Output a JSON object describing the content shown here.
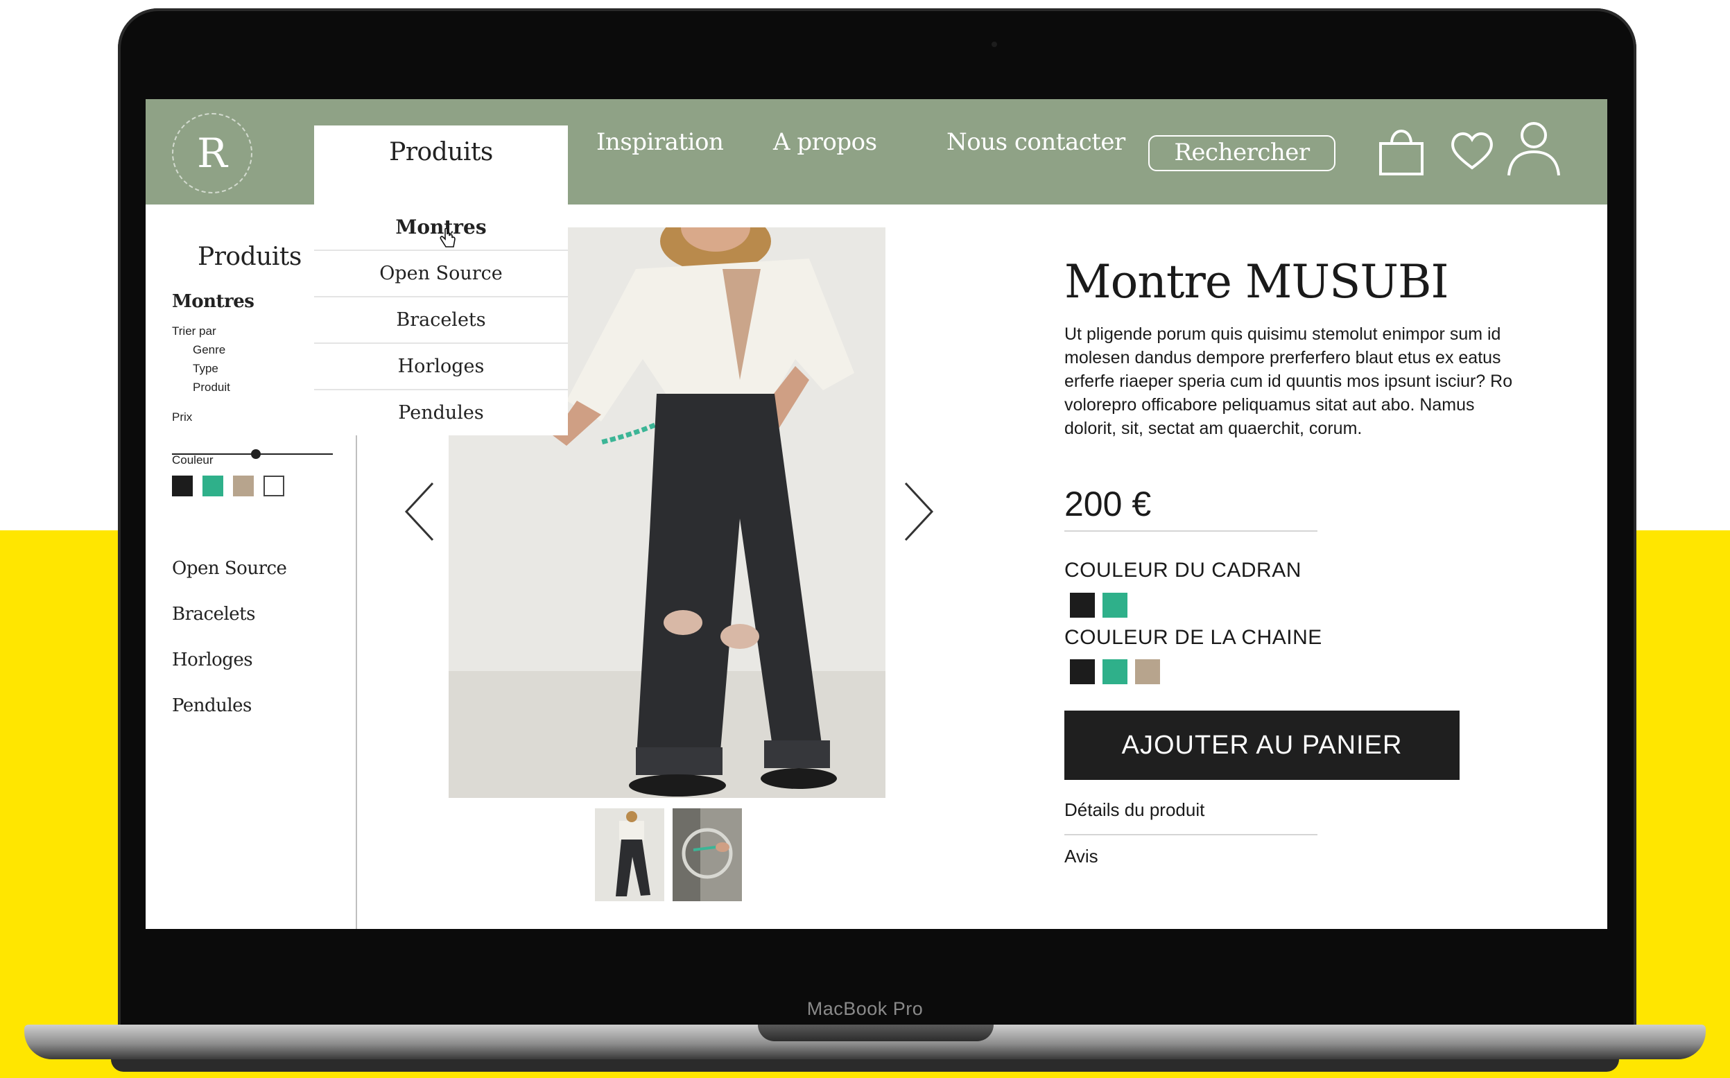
{
  "device": {
    "chin_label": "MacBook Pro"
  },
  "header": {
    "logo_letter": "R",
    "nav": {
      "produits": "Produits",
      "inspiration": "Inspiration",
      "apropos": "A propos",
      "contact": "Nous contacter"
    },
    "search_label": "Rechercher",
    "icons": [
      "shopping-bag-icon",
      "heart-icon",
      "user-icon"
    ]
  },
  "dropdown": {
    "items": [
      "Montres",
      "Open Source",
      "Bracelets",
      "Horloges",
      "Pendules"
    ]
  },
  "sidebar": {
    "title": "Produits",
    "active_category": "Montres",
    "sort_label": "Trier par",
    "sort_options": [
      "Genre",
      "Type",
      "Produit"
    ],
    "price_label": "Prix",
    "price_level": 0.52,
    "color_label": "Couleur",
    "colors": [
      "#1c1c1c",
      "#2fb08a",
      "#b7a48d",
      "#ffffff"
    ],
    "categories": [
      "Open Source",
      "Bracelets",
      "Horloges",
      "Pendules"
    ]
  },
  "product": {
    "title": "Montre MUSUBI",
    "description": "Ut pligende porum quis quisimu stemolut enimpor sum id molesen dandus dempore prerferfero blaut etus ex eatus erferfe riaeper speria cum id quuntis mos ipsunt isciur? Ro volorepro officabore peliquamus sitat aut abo. Namus dolorit, sit, sectat am quaerchit, corum.",
    "price": "200 €",
    "dial_color_label": "COULEUR DU CADRAN",
    "dial_colors": [
      "#1c1c1c",
      "#2fb08a"
    ],
    "chain_color_label": "COULEUR DE LA CHAINE",
    "chain_colors": [
      "#1c1c1c",
      "#2fb08a",
      "#b7a48d"
    ],
    "cta_label": "AJOUTER AU PANIER",
    "details_link": "Détails du produit",
    "reviews_link": "Avis"
  },
  "colors": {
    "header_bg": "#8fa286",
    "accent_yellow": "#ffe600"
  }
}
